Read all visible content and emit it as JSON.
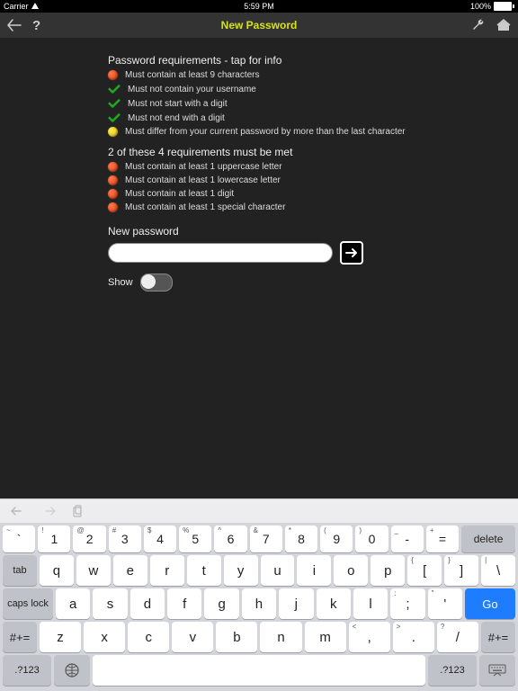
{
  "statusbar": {
    "carrier": "Carrier",
    "time": "5:59 PM",
    "battery": "100%"
  },
  "nav": {
    "title": "New Password"
  },
  "sections": {
    "reqTitle": "Password requirements - tap for info",
    "req": [
      {
        "icon": "red",
        "text": "Must contain at least 9 characters"
      },
      {
        "icon": "check",
        "text": "Must not contain your username"
      },
      {
        "icon": "check",
        "text": "Must not start with a digit"
      },
      {
        "icon": "check",
        "text": "Must not end with a digit"
      },
      {
        "icon": "yellow",
        "text": "Must differ from your current password by more than the last character"
      }
    ],
    "subTitle": "2 of these 4 requirements must be met",
    "sub": [
      {
        "icon": "red",
        "text": "Must contain at least 1 uppercase letter"
      },
      {
        "icon": "red",
        "text": "Must contain at least 1 lowercase letter"
      },
      {
        "icon": "red",
        "text": "Must contain at least 1 digit"
      },
      {
        "icon": "red",
        "text": "Must contain at least 1 special character"
      }
    ],
    "newPwdLabel": "New password",
    "showLabel": "Show"
  },
  "keyboard": {
    "row1": [
      {
        "sup": "~",
        "main": "`"
      },
      {
        "sup": "!",
        "main": "1"
      },
      {
        "sup": "@",
        "main": "2"
      },
      {
        "sup": "#",
        "main": "3"
      },
      {
        "sup": "$",
        "main": "4"
      },
      {
        "sup": "%",
        "main": "5"
      },
      {
        "sup": "^",
        "main": "6"
      },
      {
        "sup": "&",
        "main": "7"
      },
      {
        "sup": "*",
        "main": "8"
      },
      {
        "sup": "(",
        "main": "9"
      },
      {
        "sup": ")",
        "main": "0"
      },
      {
        "sup": "_",
        "main": "-"
      },
      {
        "sup": "+",
        "main": "="
      }
    ],
    "delete": "delete",
    "tab": "tab",
    "row2": [
      "q",
      "w",
      "e",
      "r",
      "t",
      "y",
      "u",
      "i",
      "o",
      "p"
    ],
    "row2b": [
      {
        "sup": "{",
        "main": "["
      },
      {
        "sup": "}",
        "main": "]"
      },
      {
        "sup": "|",
        "main": "\\"
      }
    ],
    "caps": "caps lock",
    "row3": [
      "a",
      "s",
      "d",
      "f",
      "g",
      "h",
      "j",
      "k",
      "l"
    ],
    "row3b": [
      {
        "sup": ":",
        "main": ";"
      },
      {
        "sup": "\"",
        "main": "'"
      }
    ],
    "go": "Go",
    "shift": "#+=",
    "row4": [
      "z",
      "x",
      "c",
      "v",
      "b",
      "n",
      "m"
    ],
    "row4b": [
      {
        "sup": "<",
        "main": ","
      },
      {
        "sup": ">",
        "main": "."
      },
      {
        "sup": "?",
        "main": "/"
      }
    ],
    "shiftR": "#+=",
    "abc": ".?123",
    "abcR": ".?123"
  }
}
